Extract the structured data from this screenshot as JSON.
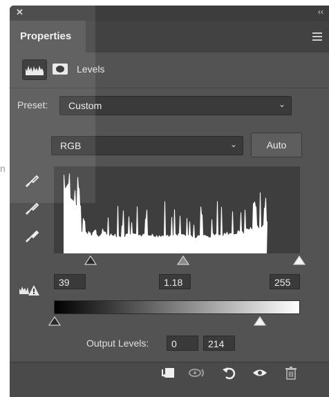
{
  "panel": {
    "title": "Properties"
  },
  "adjustment": {
    "name": "Levels",
    "icons": [
      "levels-histogram-icon",
      "layer-mask-icon"
    ]
  },
  "preset": {
    "label": "Preset:",
    "value": "Custom"
  },
  "channel": {
    "value": "RGB",
    "auto_label": "Auto"
  },
  "input_levels": {
    "black": "39",
    "gamma": "1.18",
    "white": "255"
  },
  "output_levels": {
    "label": "Output Levels:",
    "low": "0",
    "high": "214"
  },
  "edge_text": "n",
  "colors": {
    "panel_bg": "#535353",
    "field_bg": "#3a3a3a",
    "histogram_bg": "#3e3e3e",
    "text": "#ececec"
  },
  "bottom_icons": [
    "clip-to-layer-icon",
    "toggle-previous-state-icon",
    "reset-icon",
    "visibility-eye-icon",
    "trash-icon"
  ]
}
